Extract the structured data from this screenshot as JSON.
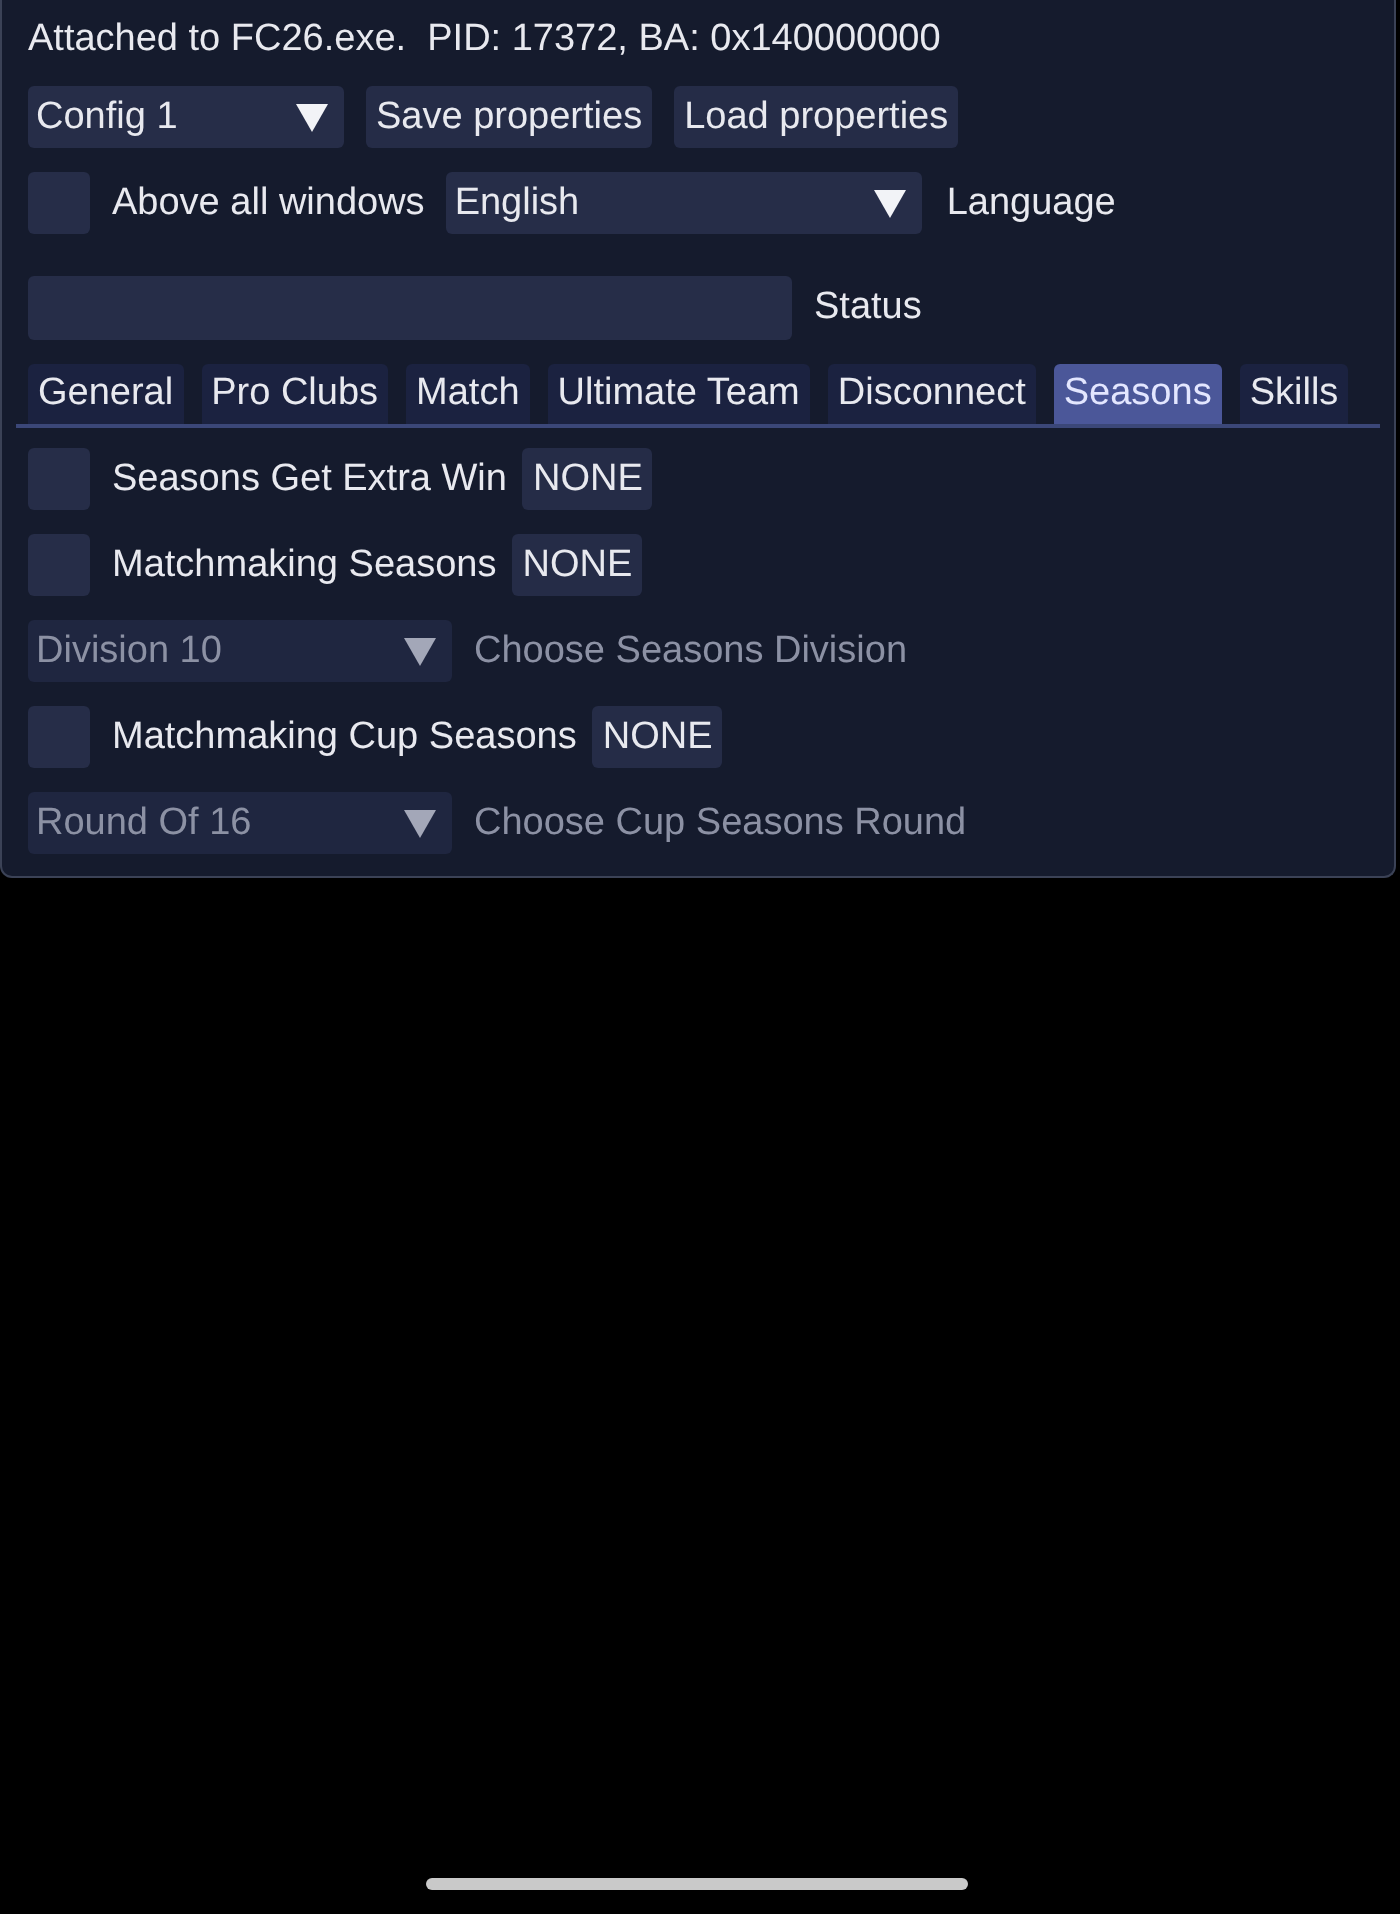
{
  "header": {
    "text": "Attached to FC26.exe.  PID: 17372, BA: 0x140000000"
  },
  "config_row": {
    "combo": {
      "value": "Config 1"
    },
    "buttons": [
      "Save properties",
      "Load properties"
    ]
  },
  "window_row": {
    "checkbox": {
      "label": "Above all windows",
      "checked": false
    },
    "language": {
      "value": "English",
      "label": "Language"
    }
  },
  "status": {
    "label": "Status"
  },
  "tabs": [
    {
      "label": "General",
      "selected": false
    },
    {
      "label": "Pro Clubs",
      "selected": false
    },
    {
      "label": "Match",
      "selected": false
    },
    {
      "label": "Ultimate Team",
      "selected": false
    },
    {
      "label": "Disconnect",
      "selected": false
    },
    {
      "label": "Seasons",
      "selected": true
    },
    {
      "label": "Skills",
      "selected": false
    }
  ],
  "seasons": [
    {
      "kind": "checkbox",
      "label": "Seasons Get Extra Win",
      "checked": false,
      "hotkey": "NONE"
    },
    {
      "kind": "checkbox",
      "label": "Matchmaking Seasons",
      "checked": false,
      "hotkey": "NONE"
    },
    {
      "kind": "combo",
      "selected_option": "Division 10",
      "caption": "Choose Seasons Division",
      "disabled": true
    },
    {
      "kind": "checkbox",
      "label": "Matchmaking Cup Seasons",
      "checked": false,
      "hotkey": "NONE"
    },
    {
      "kind": "combo",
      "selected_option": "Round Of 16",
      "caption": "Choose Cup Seasons Round",
      "disabled": true
    }
  ]
}
